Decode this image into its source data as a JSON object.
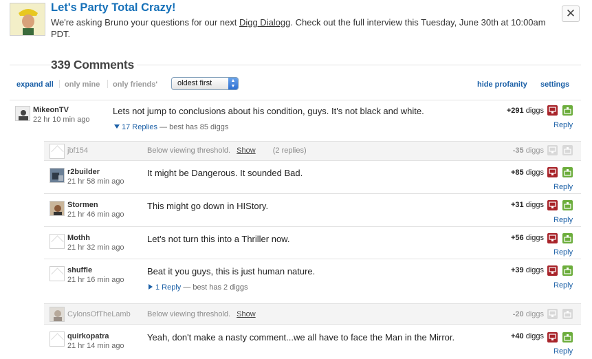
{
  "banner": {
    "title": "Let's Party Total Crazy!",
    "text_before": "We're asking Bruno your questions for our next",
    "link": "Digg Dialogg",
    "text_after": ". Check out the full interview this Tuesday, June 30th at 10:00am PDT.",
    "close_label": "✕"
  },
  "comments_header": {
    "count_title": "339 Comments"
  },
  "toolbar": {
    "expand_all": "expand all",
    "only_mine": "only mine",
    "only_friends": "only friends'",
    "sort_value": "oldest first",
    "hide_profanity": "hide profanity",
    "settings": "settings"
  },
  "labels": {
    "reply": "Reply",
    "diggs": "diggs",
    "show": "Show"
  },
  "colors": {
    "link_blue": "#1a5fa6",
    "title_blue": "#1570b8",
    "bury_red": "#a8242a",
    "digg_green": "#6cad3c"
  },
  "comments": [
    {
      "user": "MikeonTV",
      "time": "22 hr 10 min ago",
      "text": "Lets not jump to conclusions about his condition, guys. It's not black and white.",
      "score": "+291",
      "replies": "17 Replies",
      "best": " — best has 85 diggs"
    },
    {
      "user": "jbf154",
      "threshold_text": "Below viewing threshold.",
      "replies_note": "(2 replies)",
      "score": "-35"
    },
    {
      "user": "r2builder",
      "time": "21 hr 58 min ago",
      "text": "It might be Dangerous. It sounded Bad.",
      "score": "+85"
    },
    {
      "user": "Stormen",
      "time": "21 hr 46 min ago",
      "text": "This might go down in HIStory.",
      "score": "+31"
    },
    {
      "user": "Mothh",
      "time": "21 hr 32 min ago",
      "text": "Let's not turn this into a Thriller now.",
      "score": "+56"
    },
    {
      "user": "shuffle",
      "time": "21 hr 16 min ago",
      "text": "Beat it you guys, this is just human nature.",
      "score": "+39",
      "replies": "1 Reply",
      "best": " — best has 2 diggs"
    },
    {
      "user": "CylonsOfTheLamb",
      "threshold_text": "Below viewing threshold.",
      "score": "-20"
    },
    {
      "user": "quirkopatra",
      "time": "21 hr 14 min ago",
      "text": "Yeah, don't make a nasty comment...we all have to face the Man in the Mirror.",
      "score": "+40"
    }
  ]
}
